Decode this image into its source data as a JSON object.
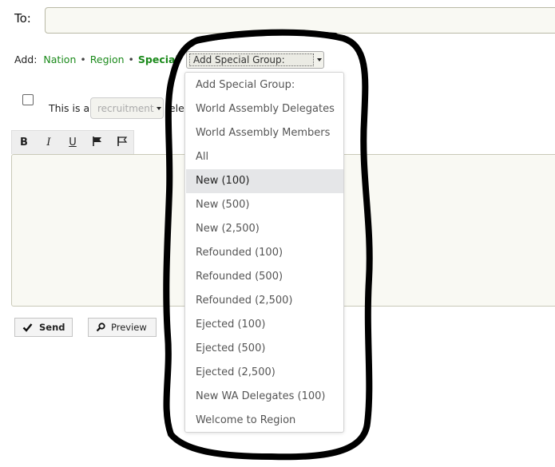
{
  "to": {
    "label": "To:",
    "value": ""
  },
  "add_row": {
    "label": "Add:",
    "links": [
      "Nation",
      "Region",
      "Special"
    ],
    "separator": "•",
    "special_select_value": "Add Special Group:"
  },
  "telegram_type": {
    "prefix": "This is a",
    "selected": "recruitment",
    "suffix": "tele"
  },
  "toolbar": {
    "bold": "B",
    "italic": "I",
    "underline": "U",
    "flag_icon": "flag-filled-icon",
    "flag_outline_icon": "flag-outline-icon"
  },
  "buttons": {
    "send": "Send",
    "preview": "Preview",
    "send_icon": "checkmark-icon",
    "preview_icon": "magnifier-icon"
  },
  "dropdown": {
    "highlighted_index": 4,
    "options": [
      "Add Special Group:",
      "World Assembly Delegates",
      "World Assembly Members",
      "All",
      "New (100)",
      "New (500)",
      "New (2,500)",
      "Refounded (100)",
      "Refounded (500)",
      "Refounded (2,500)",
      "Ejected (100)",
      "Ejected (500)",
      "Ejected (2,500)",
      "New WA Delegates (100)",
      "Welcome to Region"
    ]
  },
  "colors": {
    "link_green": "#1b8a1b",
    "annotation_stroke": "#000000",
    "highlight": "#e5e6e8"
  }
}
